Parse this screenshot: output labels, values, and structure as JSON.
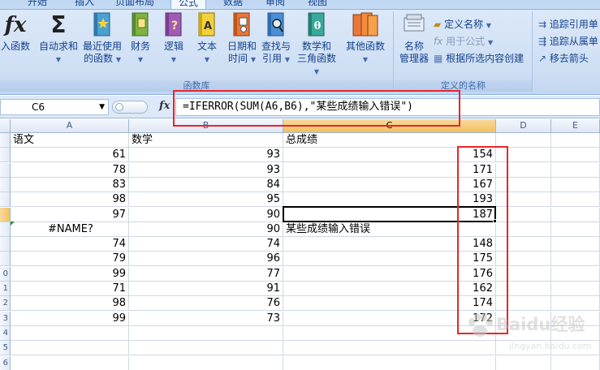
{
  "tabs": [
    "开始",
    "插入",
    "页面布局",
    "公式",
    "数据",
    "审阅",
    "视图"
  ],
  "active_tab": "公式",
  "ribbon": {
    "function_library": {
      "label": "函数库",
      "buttons": [
        {
          "line1": "入函数",
          "line2": "",
          "icon": "fx-icon"
        },
        {
          "line1": "自动求和",
          "line2": "",
          "icon": "sigma-icon",
          "caret": "▼"
        },
        {
          "line1": "最近使用",
          "line2": "的函数",
          "icon": "recent-functions-book-icon",
          "caret": "▼"
        },
        {
          "line1": "财务",
          "line2": "",
          "icon": "financial-book-icon",
          "caret": "▼"
        },
        {
          "line1": "逻辑",
          "line2": "",
          "icon": "logical-book-icon",
          "caret": "▼"
        },
        {
          "line1": "文本",
          "line2": "",
          "icon": "text-book-icon",
          "caret": "▼"
        },
        {
          "line1": "日期和",
          "line2": "时间",
          "icon": "date-time-book-icon",
          "caret": "▼"
        },
        {
          "line1": "查找与",
          "line2": "引用",
          "icon": "lookup-book-icon",
          "caret": "▼"
        },
        {
          "line1": "数学和",
          "line2": "三角函数",
          "icon": "math-trig-book-icon",
          "caret": "▼"
        },
        {
          "line1": "其他函数",
          "line2": "",
          "icon": "more-functions-book-icon",
          "caret": "▼"
        }
      ]
    },
    "defined_names": {
      "label": "定义的名称",
      "name_manager": {
        "line1": "名称",
        "line2": "管理器",
        "icon": "name-manager-icon"
      },
      "define_name": "定义名称",
      "use_in_formula": "用于公式",
      "create_from_selection": "根据所选内容创建"
    },
    "formula_auditing": {
      "trace_precedents": "追踪引用单",
      "trace_dependents": "追踪从属单",
      "remove_arrows": "移去箭头"
    }
  },
  "formula_bar": {
    "name_box": "C6",
    "fx_label": "fx",
    "formula": "=IFERROR(SUM(A6,B6),\"某些成绩输入错误\")"
  },
  "columns": [
    "A",
    "B",
    "C",
    "D",
    "E"
  ],
  "selected_column": "C",
  "rows": [
    {
      "n": "",
      "a": "语文",
      "b": "数学",
      "c": "总成绩",
      "d": ""
    },
    {
      "n": "",
      "a": "61",
      "b": "93",
      "c": "",
      "d": "154"
    },
    {
      "n": "",
      "a": "78",
      "b": "93",
      "c": "",
      "d": "171"
    },
    {
      "n": "",
      "a": "83",
      "b": "84",
      "c": "",
      "d": "167"
    },
    {
      "n": "",
      "a": "98",
      "b": "95",
      "c": "",
      "d": "193"
    },
    {
      "n": "",
      "a": "97",
      "b": "90",
      "c": "",
      "d": "187"
    },
    {
      "n": "",
      "a": "#NAME?",
      "b": "90",
      "c": "某些成绩输入错误",
      "d": ""
    },
    {
      "n": "",
      "a": "74",
      "b": "74",
      "c": "",
      "d": "148"
    },
    {
      "n": "",
      "a": "79",
      "b": "96",
      "c": "",
      "d": "175"
    },
    {
      "n": "0",
      "a": "99",
      "b": "77",
      "c": "",
      "d": "176"
    },
    {
      "n": "1",
      "a": "71",
      "b": "91",
      "c": "",
      "d": "162"
    },
    {
      "n": "2",
      "a": "98",
      "b": "76",
      "c": "",
      "d": "174"
    },
    {
      "n": "3",
      "a": "99",
      "b": "73",
      "c": "",
      "d": "172"
    },
    {
      "n": "4",
      "a": "",
      "b": "",
      "c": "",
      "d": ""
    },
    {
      "n": "5",
      "a": "",
      "b": "",
      "c": "",
      "d": ""
    },
    {
      "n": "6",
      "a": "",
      "b": "",
      "c": "",
      "d": ""
    }
  ],
  "selected_row_index": 5,
  "colors": {
    "highlight_red": "#e8252a",
    "selected_header": "#f1c15f",
    "error_triangle": "#2c8a2c"
  },
  "watermark": {
    "text": "Baidu经验",
    "url": "jingyan.baidu.com"
  }
}
